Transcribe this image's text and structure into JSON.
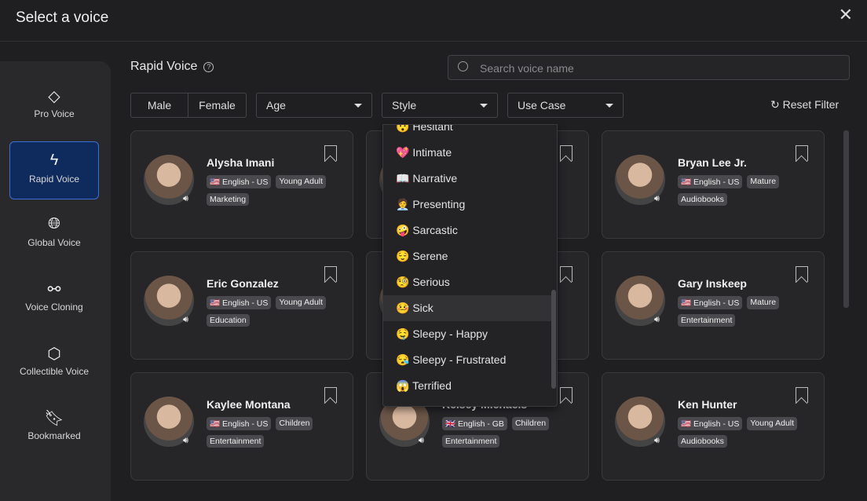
{
  "header": {
    "title": "Select a voice",
    "close": "✕"
  },
  "sidebar": {
    "items": [
      {
        "label": "Pro Voice",
        "icon": "diamond-icon",
        "glyph": "◇",
        "active": false
      },
      {
        "label": "Rapid Voice",
        "icon": "lightning-icon",
        "glyph": "ϟ",
        "active": true
      },
      {
        "label": "Global Voice",
        "icon": "translate-globe-icon",
        "glyph": "🌐︎",
        "active": false
      },
      {
        "label": "Voice Cloning",
        "icon": "dna-icon",
        "glyph": "⚯",
        "active": false
      },
      {
        "label": "Collectible Voice",
        "icon": "cube-icon",
        "glyph": "⬡",
        "active": false
      },
      {
        "label": "Bookmarked",
        "icon": "bookmark-icon",
        "glyph": "🔖︎",
        "active": false
      }
    ]
  },
  "main": {
    "title": "Rapid Voice",
    "help": "?",
    "search": {
      "placeholder": "Search voice name",
      "value": ""
    },
    "filters": {
      "male": "Male",
      "female": "Female",
      "age": "Age",
      "style": "Style",
      "use_case": "Use Case",
      "reset": "Reset Filter"
    },
    "style_dropdown": {
      "options": [
        {
          "emoji": "😯",
          "label": "Hesitant"
        },
        {
          "emoji": "💖",
          "label": "Intimate"
        },
        {
          "emoji": "📖",
          "label": "Narrative"
        },
        {
          "emoji": "🧑‍💼",
          "label": "Presenting"
        },
        {
          "emoji": "🤪",
          "label": "Sarcastic"
        },
        {
          "emoji": "😌",
          "label": "Serene"
        },
        {
          "emoji": "🧐",
          "label": "Serious"
        },
        {
          "emoji": "🤒",
          "label": "Sick"
        },
        {
          "emoji": "🤤",
          "label": "Sleepy - Happy"
        },
        {
          "emoji": "😪",
          "label": "Sleepy - Frustrated"
        },
        {
          "emoji": "😱",
          "label": "Terrified"
        }
      ],
      "highlighted": "Sick"
    },
    "voices": [
      {
        "name": "Alysha Imani",
        "lang": "🇺🇸 English - US",
        "age": "Young Adult",
        "use": "Marketing"
      },
      {
        "name": "",
        "lang": "",
        "age": "",
        "use": ""
      },
      {
        "name": "Bryan Lee Jr.",
        "lang": "🇺🇸 English - US",
        "age": "Mature",
        "use": "Audiobooks"
      },
      {
        "name": "Eric Gonzalez",
        "lang": "🇺🇸 English - US",
        "age": "Young Adult",
        "use": "Education"
      },
      {
        "name": "",
        "lang": "",
        "age": "",
        "use": ""
      },
      {
        "name": "Gary Inskeep",
        "lang": "🇺🇸 English - US",
        "age": "Mature",
        "use": "Entertainment"
      },
      {
        "name": "Kaylee Montana",
        "lang": "🇺🇸 English - US",
        "age": "Children",
        "use": "Entertainment"
      },
      {
        "name": "Kelsey Michaels",
        "lang": "🇬🇧 English - GB",
        "age": "Children",
        "use": "Entertainment"
      },
      {
        "name": "Ken Hunter",
        "lang": "🇺🇸 English - US",
        "age": "Young Adult",
        "use": "Audiobooks"
      }
    ]
  }
}
